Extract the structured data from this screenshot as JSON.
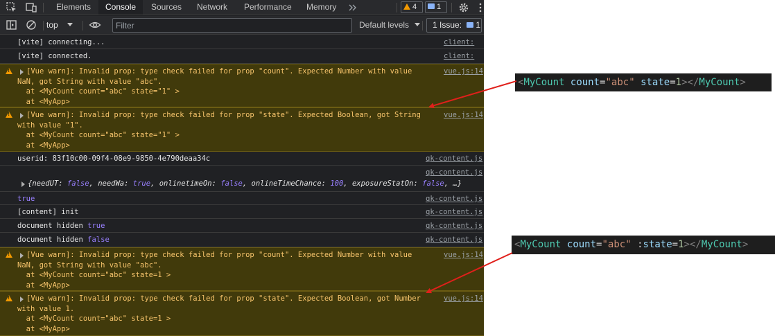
{
  "tabs": [
    {
      "label": "Elements",
      "active": false
    },
    {
      "label": "Console",
      "active": true
    },
    {
      "label": "Sources",
      "active": false
    },
    {
      "label": "Network",
      "active": false
    },
    {
      "label": "Performance",
      "active": false
    },
    {
      "label": "Memory",
      "active": false
    }
  ],
  "tabbar": {
    "more_icon": "chevron-double-right-icon",
    "warning_count": "4",
    "message_count": "1",
    "settings_icon": "gear-icon",
    "menu_icon": "kebab-menu-icon"
  },
  "toolbar": {
    "context": "top",
    "filter_placeholder": "Filter",
    "levels": "Default levels",
    "issues_label": "1 Issue:",
    "issues_count": "1"
  },
  "console": [
    {
      "type": "log",
      "text": "[vite] connecting...",
      "source": "client:"
    },
    {
      "type": "log",
      "text": "[vite] connected.",
      "source": "client:"
    },
    {
      "type": "warn",
      "text": "[Vue warn]: Invalid prop: type check failed for prop \"count\". Expected Number with value\nNaN, got String with value \"abc\".\n  at <MyCount count=\"abc\" state=\"1\" >\n  at <MyApp>",
      "source": "vue.js:14"
    },
    {
      "type": "warn",
      "text": "[Vue warn]: Invalid prop: type check failed for prop \"state\". Expected Boolean, got String\nwith value \"1\".\n  at <MyCount count=\"abc\" state=\"1\" >\n  at <MyApp>",
      "source": "vue.js:14"
    },
    {
      "type": "log",
      "text": "userid: 83f10c00-09f4-08e9-9850-4e790deaa34c",
      "source": "qk-content.js"
    },
    {
      "type": "log",
      "text": "",
      "source": "qk-content.js"
    },
    {
      "type": "object",
      "text": "{needUT: false, needWa: true, onlinetimeOn: false, onlineTimeChance: 100, exposureStatOn: false, …}"
    },
    {
      "type": "log",
      "text": "true",
      "source": "qk-content.js"
    },
    {
      "type": "log",
      "text": "[content] init",
      "source": "qk-content.js"
    },
    {
      "type": "log",
      "text": "document hidden",
      "value": "true",
      "source": "qk-content.js"
    },
    {
      "type": "log",
      "text": "document hidden",
      "value": "false",
      "source": "qk-content.js"
    },
    {
      "type": "warn",
      "text": "[Vue warn]: Invalid prop: type check failed for prop \"count\". Expected Number with value\nNaN, got String with value \"abc\".\n  at <MyCount count=\"abc\" state=1 >\n  at <MyApp>",
      "source": "vue.js:14"
    },
    {
      "type": "warn",
      "text": "[Vue warn]: Invalid prop: type check failed for prop \"state\". Expected Boolean, got Number\nwith value 1.\n  at <MyCount count=\"abc\" state=1 >\n  at <MyApp>",
      "source": "vue.js:14"
    }
  ],
  "snippets": [
    {
      "code": "<MyCount count=\"abc\" state=1></MyCount>"
    },
    {
      "code": "<MyCount count=\"abc\" :state=1></MyCount>"
    }
  ],
  "colors": {
    "arrow": "#e0201b",
    "warn_bg": "#413a0b",
    "warn_text": "#f7c46c"
  }
}
